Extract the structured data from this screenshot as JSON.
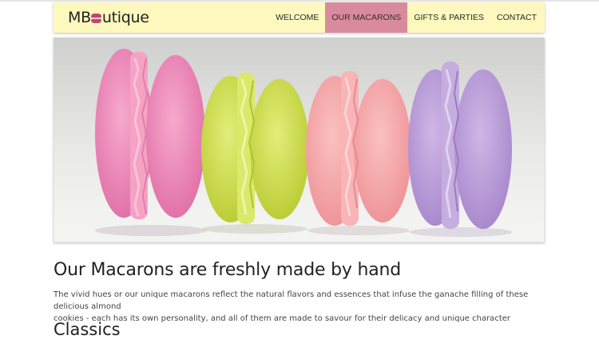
{
  "brand": {
    "prefix": "MB",
    "suffix": "utique",
    "accent_color": "#c2456e"
  },
  "nav": {
    "items": [
      {
        "label": "WELCOME",
        "active": false
      },
      {
        "label": "OUR MACARONS",
        "active": true
      },
      {
        "label": "GIFTS & PARTIES",
        "active": false
      },
      {
        "label": "CONTACT",
        "active": false
      }
    ],
    "background": "#fdf8bd",
    "active_background": "#d98b9d"
  },
  "hero": {
    "subject": "four-macarons-photo",
    "macaron_colors": [
      "#ec8ab5",
      "#cfe04a",
      "#f4a3a8",
      "#b89ad4"
    ]
  },
  "content": {
    "heading": "Our Macarons are freshly made by hand",
    "intro_line1": "The vivid hues or our unique macarons reflect the natural flavors and essences that infuse the ganache filling of these delicious almond",
    "intro_line2": "cookies - each has its own personality, and all of them are made to savour for their delicacy and unique character",
    "subheading": "Classics"
  }
}
